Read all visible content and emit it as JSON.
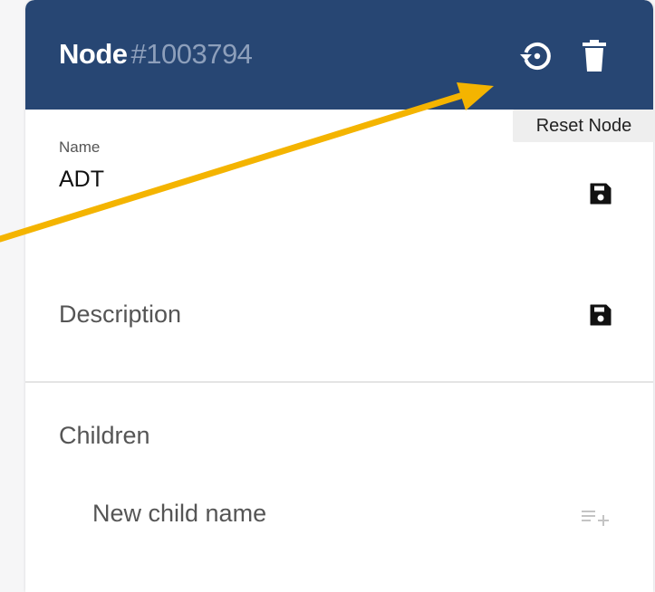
{
  "header": {
    "title": "Node",
    "node_id": "#1003794",
    "background": "#274673"
  },
  "actions": {
    "reset_icon": "restore-icon",
    "delete_icon": "trash-icon",
    "reset_tooltip": "Reset Node"
  },
  "fields": {
    "name_label": "Name",
    "name_value": "ADT",
    "description_label": "Description",
    "save_icon": "floppy-disk-icon"
  },
  "children": {
    "label": "Children",
    "input_placeholder": "New child name",
    "add_icon": "playlist-add-icon"
  },
  "annotation": {
    "arrow_color": "#f4b400"
  }
}
